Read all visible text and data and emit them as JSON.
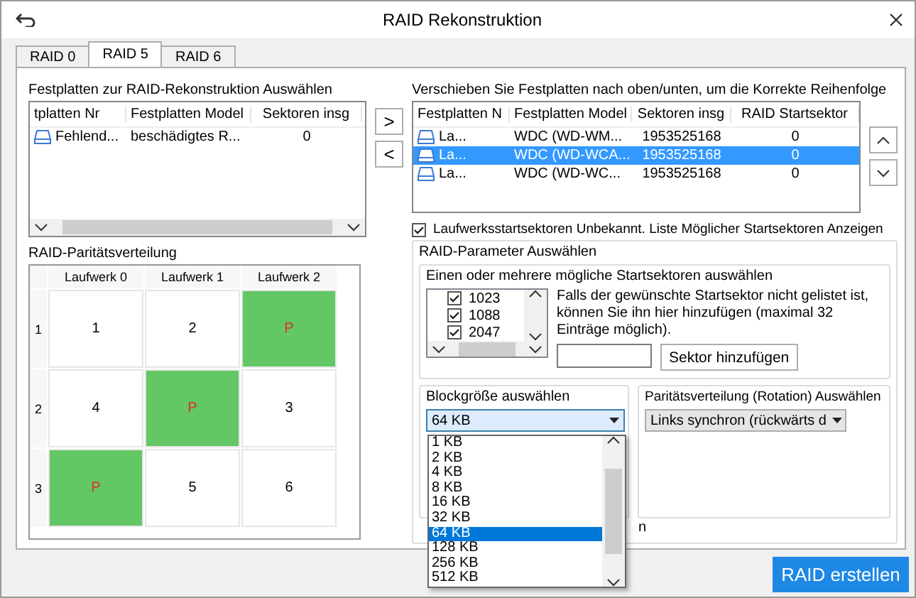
{
  "window": {
    "title": "RAID Rekonstruktion"
  },
  "tabs": [
    {
      "label": "RAID 0",
      "selected": false
    },
    {
      "label": "RAID 5",
      "selected": true
    },
    {
      "label": "RAID 6",
      "selected": false
    }
  ],
  "source": {
    "label": "Festplatten zur RAID-Rekonstruktion Auswählen",
    "columns": [
      "tplatten Nr",
      "Festplatten Model",
      "Sektoren insg"
    ],
    "rows": [
      {
        "cells": [
          "Fehlend...",
          "beschädigtes R...",
          "0"
        ],
        "selected": false
      }
    ]
  },
  "move_buttons": [
    ">",
    "<"
  ],
  "target": {
    "label": "Verschieben Sie Festplatten nach oben/unten, um die Korrekte Reihenfolge",
    "columns": [
      "Festplatten N",
      "Festplatten Model",
      "Sektoren insg",
      "RAID Startsektor"
    ],
    "rows": [
      {
        "cells": [
          "La...",
          "WDC (WD-WM...",
          "1953525168",
          "0"
        ],
        "selected": false
      },
      {
        "cells": [
          "La...",
          "WDC (WD-WCA...",
          "1953525168",
          "0"
        ],
        "selected": true
      },
      {
        "cells": [
          "La...",
          "WDC (WD-WC...",
          "1953525168",
          "0"
        ],
        "selected": false
      }
    ]
  },
  "unknown_start": {
    "label": "Laufwerksstartsektoren Unbekannt. Liste Möglicher Startsektoren Anzeigen",
    "checked": true
  },
  "params": {
    "title": "RAID-Parameter Auswählen",
    "sectors": {
      "title": "Einen oder mehrere mögliche Startsektoren auswählen",
      "items": [
        {
          "label": "1023",
          "checked": true
        },
        {
          "label": "1088",
          "checked": true
        },
        {
          "label": "2047",
          "checked": true
        }
      ],
      "hint": "Falls der gewünschte Startsektor nicht gelistet ist, können Sie ihn hier hinzufügen (maximal 32 Einträge möglich).",
      "add_button": "Sektor hinzufügen"
    },
    "block": {
      "title": "Blockgröße auswählen",
      "value": "64 KB",
      "expanded": true,
      "options": [
        {
          "label": "1 KB",
          "selected": false
        },
        {
          "label": "2 KB",
          "selected": false
        },
        {
          "label": "4 KB",
          "selected": false
        },
        {
          "label": "8 KB",
          "selected": false
        },
        {
          "label": "16 KB",
          "selected": false
        },
        {
          "label": "32 KB",
          "selected": false
        },
        {
          "label": "64 KB",
          "selected": true
        },
        {
          "label": "128 KB",
          "selected": false
        },
        {
          "label": "256 KB",
          "selected": false
        },
        {
          "label": "512 KB",
          "selected": false
        }
      ]
    },
    "rotation": {
      "title": "Paritätsverteilung (Rotation) Auswählen",
      "value": "Links synchron (rückwärts d"
    },
    "covered_text": "n"
  },
  "parity": {
    "title": "RAID-Paritätsverteilung",
    "columns": [
      "Laufwerk 0",
      "Laufwerk 1",
      "Laufwerk 2"
    ],
    "rows": [
      {
        "label": "1",
        "cells": [
          {
            "text": "1",
            "parity": false
          },
          {
            "text": "2",
            "parity": false
          },
          {
            "text": "P",
            "parity": true
          }
        ]
      },
      {
        "label": "2",
        "cells": [
          {
            "text": "4",
            "parity": false
          },
          {
            "text": "P",
            "parity": true
          },
          {
            "text": "3",
            "parity": false
          }
        ]
      },
      {
        "label": "3",
        "cells": [
          {
            "text": "P",
            "parity": true
          },
          {
            "text": "5",
            "parity": false
          },
          {
            "text": "6",
            "parity": false
          }
        ]
      }
    ]
  },
  "create_button": "RAID erstellen"
}
